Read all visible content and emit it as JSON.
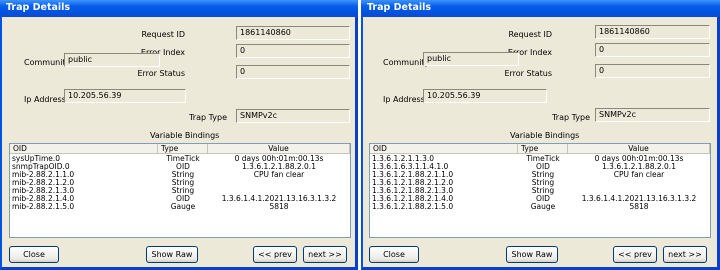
{
  "dialogs": [
    {
      "title": "Trap Details",
      "labels": {
        "request_id": "Request ID",
        "error_index": "Error Index",
        "error_status": "Error Status",
        "community": "Community",
        "ip_address": "Ip Address",
        "trap_type": "Trap Type",
        "variable_bindings": "Variable Bindings"
      },
      "values": {
        "request_id": "1861140860",
        "error_index": "0",
        "error_status": "0",
        "community": "public",
        "ip_address": "10.205.56.39",
        "trap_type": "SNMPv2c"
      },
      "columns": [
        "OID",
        "Type",
        "Value"
      ],
      "rows": [
        [
          "sysUpTime.0",
          "TimeTick",
          "0 days 00h:01m:00.13s"
        ],
        [
          "snmpTrapOID.0",
          "OID",
          "1.3.6.1.2.1.88.2.0.1"
        ],
        [
          "mib-2.88.2.1.1.0",
          "String",
          "CPU fan clear"
        ],
        [
          "mib-2.88.2.1.2.0",
          "String",
          ""
        ],
        [
          "mib-2.88.2.1.3.0",
          "String",
          ""
        ],
        [
          "mib-2.88.2.1.4.0",
          "OID",
          "1.3.6.1.4.1.2021.13.16.3.1.3.2"
        ],
        [
          "mib-2.88.2.1.5.0",
          "Gauge",
          "5818"
        ]
      ],
      "buttons": {
        "close": "Close",
        "show_raw": "Show Raw",
        "prev": "<< prev",
        "next": "next >>"
      }
    },
    {
      "title": "Trap Details",
      "labels": {
        "request_id": "Request ID",
        "error_index": "Error Index",
        "error_status": "Error Status",
        "community": "Community",
        "ip_address": "Ip Address",
        "trap_type": "Trap Type",
        "variable_bindings": "Variable Bindings"
      },
      "values": {
        "request_id": "1861140860",
        "error_index": "0",
        "error_status": "0",
        "community": "public",
        "ip_address": "10.205.56.39",
        "trap_type": "SNMPv2c"
      },
      "columns": [
        "OID",
        "Type",
        "Value"
      ],
      "rows": [
        [
          "1.3.6.1.2.1.1.3.0",
          "TimeTick",
          "0 days 00h:01m:00.13s"
        ],
        [
          "1.3.6.1.6.3.1.1.4.1.0",
          "OID",
          "1.3.6.1.2.1.88.2.0.1"
        ],
        [
          "1.3.6.1.2.1.88.2.1.1.0",
          "String",
          "CPU fan clear"
        ],
        [
          "1.3.6.1.2.1.88.2.1.2.0",
          "String",
          ""
        ],
        [
          "1.3.6.1.2.1.88.2.1.3.0",
          "String",
          ""
        ],
        [
          "1.3.6.1.2.1.88.2.1.4.0",
          "OID",
          "1.3.6.1.4.1.2021.13.16.3.1.3.2"
        ],
        [
          "1.3.6.1.2.1.88.2.1.5.0",
          "Gauge",
          "5818"
        ]
      ],
      "buttons": {
        "close": "Close",
        "show_raw": "Show Raw",
        "prev": "<< prev",
        "next": "next >>"
      }
    }
  ]
}
